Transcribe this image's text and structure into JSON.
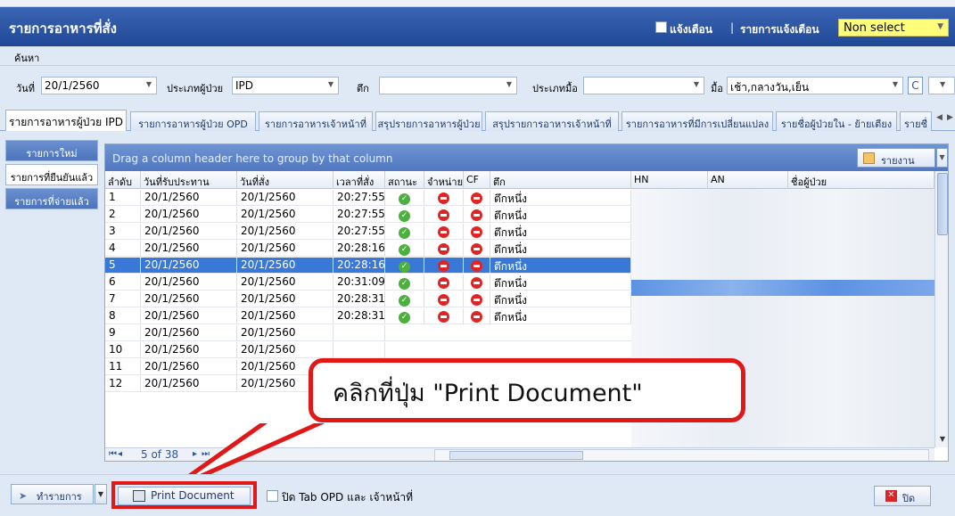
{
  "window": {
    "title": "รายการอาหารที่สั่ง",
    "notify_label": "แจ้งเตือน",
    "notify_list_label": "รายการแจ้งเตือน",
    "notify_select_value": "Non select",
    "notify_select_color": "#fffd7a",
    "title_bar_color": "#1f4796"
  },
  "search": {
    "label": "ค้นหา"
  },
  "filters": {
    "date_label": "วันที่",
    "date_value": "20/1/2560",
    "patient_type_label": "ประเภทผู้ป่วย",
    "patient_type_value": "IPD",
    "ward_label": "ตึก",
    "ward_value": "",
    "meal_type_label": "ประเภทมื้อ",
    "meal_type_value": "",
    "meal_label": "มื้อ",
    "meal_value": "เช้า,กลางวัน,เย็น",
    "c_button": "C"
  },
  "tabs": [
    "รายการอาหารผู้ป่วย IPD",
    "รายการอาหารผู้ป่วย OPD",
    "รายการอาหารเจ้าหน้าที่",
    "สรุปรายการอาหารผู้ป่วย",
    "สรุปรายการอาหารเจ้าหน้าที่",
    "รายการอาหารที่มีการเปลี่ยนแปลง",
    "รายชื่อผู้ป่วยใน - ย้ายเตียง",
    "รายชื่"
  ],
  "side_tabs": [
    "รายการใหม่",
    "รายการที่ยืนยันแล้ว",
    "รายการที่จ่ายแล้ว"
  ],
  "grid": {
    "group_hint": "Drag a column header here to group by that column",
    "report_button": "รายงาน",
    "columns": [
      "ลำดับ",
      "วันที่รับประทาน",
      "วันที่สั่ง",
      "เวลาที่สั่ง",
      "สถานะ",
      "จำหน่าย",
      "CF",
      "ตึก",
      "HN",
      "AN",
      "ชื่อผู้ป่วย"
    ],
    "rows": [
      {
        "no": "1",
        "eat_date": "20/1/2560",
        "order_date": "20/1/2560",
        "time": "20:27:55",
        "ward": "ตึกหนึ่ง"
      },
      {
        "no": "2",
        "eat_date": "20/1/2560",
        "order_date": "20/1/2560",
        "time": "20:27:55",
        "ward": "ตึกหนึ่ง"
      },
      {
        "no": "3",
        "eat_date": "20/1/2560",
        "order_date": "20/1/2560",
        "time": "20:27:55",
        "ward": "ตึกหนึ่ง"
      },
      {
        "no": "4",
        "eat_date": "20/1/2560",
        "order_date": "20/1/2560",
        "time": "20:28:16",
        "ward": "ตึกหนึ่ง"
      },
      {
        "no": "5",
        "eat_date": "20/1/2560",
        "order_date": "20/1/2560",
        "time": "20:28:16",
        "ward": "ตึกหนึ่ง"
      },
      {
        "no": "6",
        "eat_date": "20/1/2560",
        "order_date": "20/1/2560",
        "time": "20:31:09",
        "ward": "ตึกหนึ่ง"
      },
      {
        "no": "7",
        "eat_date": "20/1/2560",
        "order_date": "20/1/2560",
        "time": "20:28:31",
        "ward": "ตึกหนึ่ง"
      },
      {
        "no": "8",
        "eat_date": "20/1/2560",
        "order_date": "20/1/2560",
        "time": "20:28:31",
        "ward": "ตึกหนึ่ง"
      },
      {
        "no": "9",
        "eat_date": "20/1/2560",
        "order_date": "20/1/2560",
        "time": "",
        "ward": ""
      },
      {
        "no": "10",
        "eat_date": "20/1/2560",
        "order_date": "20/1/2560",
        "time": "",
        "ward": ""
      },
      {
        "no": "11",
        "eat_date": "20/1/2560",
        "order_date": "20/1/2560",
        "time": "",
        "ward": ""
      },
      {
        "no": "12",
        "eat_date": "20/1/2560",
        "order_date": "20/1/2560",
        "time": "",
        "ward": ""
      }
    ],
    "selected_row": "5",
    "page_info": "5 of 38"
  },
  "callout": {
    "text": "คลิกที่ปุ่ม \"Print Document\"",
    "border_color": "#e01818"
  },
  "bottom": {
    "action_button": "ทำรายการ",
    "print_button": "Print Document",
    "checkbox_label": "ปิด Tab  OPD และ เจ้าหน้าที่",
    "close_button": "ปิด"
  }
}
